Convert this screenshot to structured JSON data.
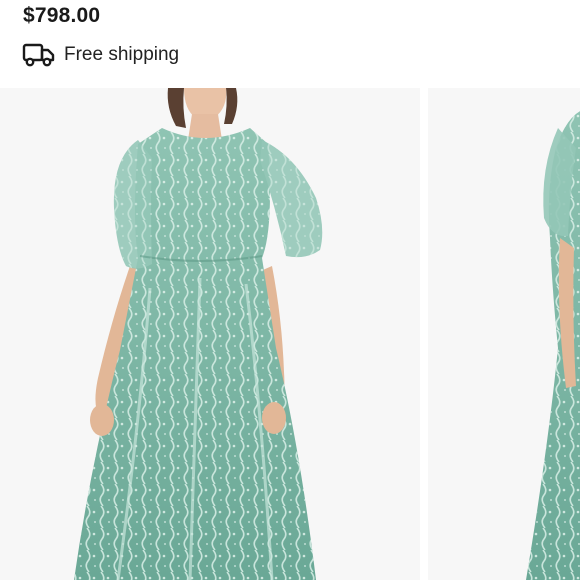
{
  "product": {
    "price": "$798.00",
    "shipping_label": "Free shipping"
  },
  "icons": {
    "shipping": "truck-icon"
  },
  "gallery": {
    "images": [
      {
        "subject": "product-photo-front"
      },
      {
        "subject": "product-photo-side"
      }
    ]
  },
  "colors": {
    "dress": "#7fb8a7",
    "background": "#f7f7f7"
  }
}
